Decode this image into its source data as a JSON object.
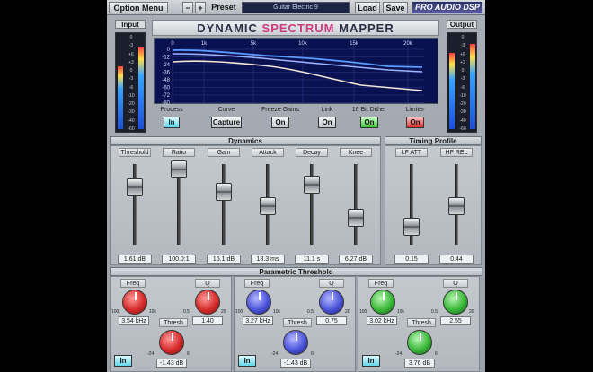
{
  "toolbar": {
    "option_menu": "Option Menu",
    "minus": "−",
    "plus": "+",
    "preset_label": "Preset",
    "preset_value": "Guitar Electric 9",
    "load": "Load",
    "save": "Save",
    "brand": "PRO AUDIO DSP"
  },
  "meters": {
    "input_label": "Input",
    "output_label": "Output",
    "scale": [
      "0",
      "-3",
      "+6",
      "+3",
      "0",
      "-3",
      "-6",
      "-10",
      "-20",
      "-30",
      "-40",
      "-60"
    ]
  },
  "title": {
    "part1": "DYNAMIC ",
    "part2": "SPECTRUM",
    "part3": " MAPPER"
  },
  "graph": {
    "freq_ticks": [
      "0",
      "1k",
      "5k",
      "10k",
      "15k",
      "20k"
    ],
    "db_ticks": [
      "0",
      "-12",
      "-24",
      "-36",
      "-48",
      "-60",
      "-72",
      "-80"
    ]
  },
  "controls": [
    {
      "label": "Process",
      "value": "In",
      "style": "cyan"
    },
    {
      "label": "Curve",
      "value": "Capture",
      "style": "plain"
    },
    {
      "label": "Freeze Gains",
      "value": "On",
      "style": "plain"
    },
    {
      "label": "Link",
      "value": "On",
      "style": "plain"
    },
    {
      "label": "16 Bit Dither",
      "value": "On",
      "style": "green"
    },
    {
      "label": "Limiter",
      "value": "On",
      "style": "red"
    }
  ],
  "dynamics": {
    "header": "Dynamics",
    "faders": [
      {
        "label": "Threshold",
        "value": "1.61 dB",
        "level": 0.73
      },
      {
        "label": "Ratio",
        "value": "100.0:1",
        "level": 0.98
      },
      {
        "label": "Gain",
        "value": "15.1 dB",
        "level": 0.66
      },
      {
        "label": "Attack",
        "value": "18.3 ms",
        "level": 0.46
      },
      {
        "label": "Decay",
        "value": "11.1 s",
        "level": 0.76
      },
      {
        "label": "Knee",
        "value": "6.27 dB",
        "level": 0.3
      }
    ]
  },
  "timing": {
    "header": "Timing Profile",
    "faders": [
      {
        "label": "LF ATT",
        "value": "0.15",
        "level": 0.18
      },
      {
        "label": "HF REL",
        "value": "0.44",
        "level": 0.46
      }
    ]
  },
  "parametric": {
    "header": "Parametric Threshold",
    "bands": [
      {
        "freq_label": "Freq",
        "freq_value": "3.54 kHz",
        "q_label": "Q",
        "q_value": "1.40",
        "thresh_label": "Thresh",
        "thresh_value": "-1.43 dB",
        "in": "In",
        "color": "red"
      },
      {
        "freq_label": "Freq",
        "freq_value": "3.27 kHz",
        "q_label": "Q",
        "q_value": "0.75",
        "thresh_label": "Thresh",
        "thresh_value": "-1.43 dB",
        "in": "In",
        "color": "blue"
      },
      {
        "freq_label": "Freq",
        "freq_value": "3.02 kHz",
        "q_label": "Q",
        "q_value": "2.55",
        "thresh_label": "Thresh",
        "thresh_value": "3.76 dB",
        "in": "In",
        "color": "green"
      }
    ],
    "knob_scale": {
      "freq_lo": "100",
      "freq_hi": "10k",
      "q_lo": "0.5",
      "q_hi": "20",
      "th_lo": "-24",
      "th_hi": "6"
    }
  },
  "colors": {
    "accent": "#3aa3ff",
    "panel": "#a9afb6",
    "graph_bg": "#0a1150"
  }
}
